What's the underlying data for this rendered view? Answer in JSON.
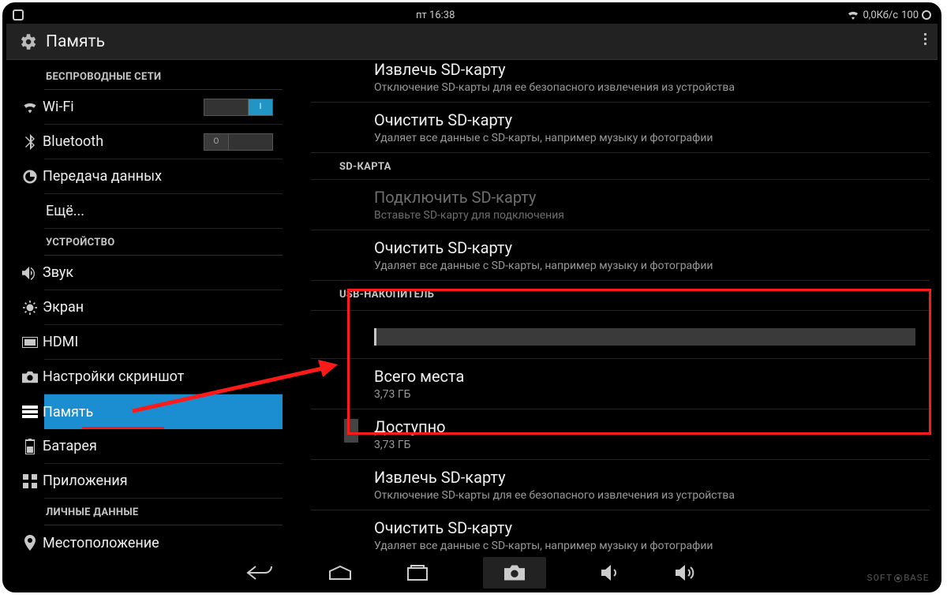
{
  "statusbar": {
    "time": "пт 16:38",
    "data_rate": "0,0Кб/с",
    "battery": "100"
  },
  "titlebar": {
    "title": "Память"
  },
  "sidebar": {
    "sections": {
      "wireless": "БЕСПРОВОДНЫЕ СЕТИ",
      "device": "УСТРОЙСТВО",
      "personal": "ЛИЧНЫЕ ДАННЫЕ"
    },
    "items": {
      "wifi": "Wi-Fi",
      "bluetooth": "Bluetooth",
      "data": "Передача данных",
      "more": "Ещё...",
      "sound": "Звук",
      "display": "Экран",
      "hdmi": "HDMI",
      "screenshot": "Настройки скриншот",
      "storage": "Память",
      "battery": "Батарея",
      "apps": "Приложения",
      "location": "Местоположение"
    },
    "switch": {
      "on": "I",
      "off": "O"
    }
  },
  "content": {
    "eject_sd": {
      "title": "Извлечь SD-карту",
      "sub": "Отключение SD-карты для ее безопасного извлечения из устройства"
    },
    "format_sd": {
      "title": "Очистить SD-карту",
      "sub": "Удаляет все данные с SD-карты, например музыку и фотографии"
    },
    "sd_section": "SD-КАРТА",
    "mount_sd": {
      "title": "Подключить SD-карту",
      "sub": "Вставьте SD-карту для подключения"
    },
    "format_sd2": {
      "title": "Очистить SD-карту",
      "sub": "Удаляет все данные с SD-карты, например музыку и фотографии"
    },
    "usb_section": "USB-НАКОПИТЕЛЬ",
    "total": {
      "title": "Всего места",
      "sub": "3,73 ГБ"
    },
    "avail": {
      "title": "Доступно",
      "sub": "3,73 ГБ"
    },
    "eject_usb": {
      "title": "Извлечь SD-карту",
      "sub": "Отключение SD-карты для ее безопасного извлечения из устройства"
    },
    "format_usb": {
      "title": "Очистить SD-карту",
      "sub": "Удаляет все данные с SD-карты, например музыку и фотографии"
    }
  },
  "watermark": {
    "left": "SOFT",
    "right": "BASE"
  }
}
